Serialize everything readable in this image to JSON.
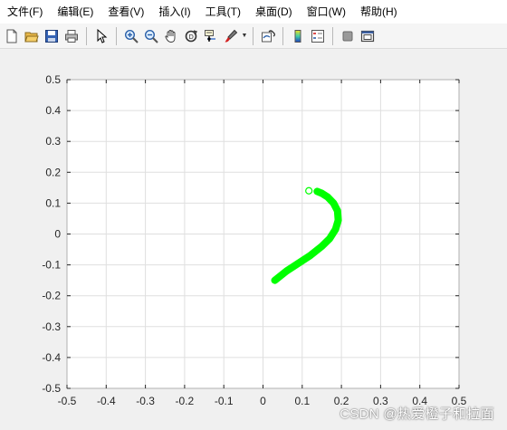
{
  "menu": [
    {
      "label": "文件(F)"
    },
    {
      "label": "编辑(E)"
    },
    {
      "label": "查看(V)"
    },
    {
      "label": "插入(I)"
    },
    {
      "label": "工具(T)"
    },
    {
      "label": "桌面(D)"
    },
    {
      "label": "窗口(W)"
    },
    {
      "label": "帮助(H)"
    }
  ],
  "toolbar_icons": [
    "new-figure-icon",
    "open-file-icon",
    "save-icon",
    "print-icon",
    "edit-plot-arrow-icon",
    "zoom-in-icon",
    "zoom-out-icon",
    "pan-hand-icon",
    "rotate-3d-icon",
    "data-cursor-icon",
    "brush-icon",
    "link-plot-icon",
    "colorbar-icon",
    "legend-icon",
    "hide-plot-tools-icon",
    "show-plot-tools-icon"
  ],
  "colors": {
    "curve": "#00ff00",
    "axes_background": "#ffffff",
    "grid": "#dfdfdf",
    "axis_line": "#262626"
  },
  "chart_data": {
    "type": "line",
    "title": "",
    "xlabel": "",
    "ylabel": "",
    "xlim": [
      -0.5,
      0.5
    ],
    "ylim": [
      -0.5,
      0.5
    ],
    "xticks": [
      "-0.5",
      "-0.4",
      "-0.3",
      "-0.2",
      "-0.1",
      "0",
      "0.1",
      "0.2",
      "0.3",
      "0.4",
      "0.5"
    ],
    "yticks": [
      "0.5",
      "0.4",
      "0.3",
      "0.2",
      "0.1",
      "0",
      "-0.1",
      "-0.2",
      "-0.3",
      "-0.4",
      "-0.5"
    ],
    "grid": true,
    "series": [
      {
        "x": [
          0.03,
          0.06,
          0.09,
          0.12,
          0.15,
          0.17,
          0.185,
          0.192,
          0.19,
          0.18,
          0.165,
          0.15,
          0.138
        ],
        "y": [
          -0.15,
          -0.12,
          -0.095,
          -0.07,
          -0.04,
          -0.015,
          0.015,
          0.045,
          0.075,
          0.1,
          0.12,
          0.132,
          0.138
        ],
        "color": "#00ff00"
      }
    ],
    "marker": {
      "x": 0.117,
      "y": 0.14,
      "shape": "open-circle",
      "color": "#00ff00"
    }
  },
  "watermark": "CSDN @热爱橙子和拉面"
}
